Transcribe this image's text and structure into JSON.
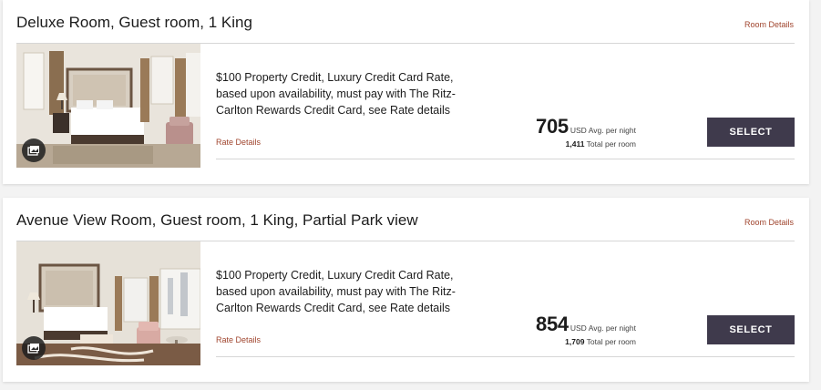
{
  "rooms": [
    {
      "title": "Deluxe Room, Guest room, 1 King",
      "room_details_label": "Room Details",
      "rate_description": "$100 Property Credit, Luxury Credit Card Rate, based upon availability, must pay with The Ritz-Carlton Rewards Credit Card, see Rate details",
      "rate_details_label": "Rate Details",
      "price": "705",
      "price_unit": "USD Avg. per night",
      "total": "1,411",
      "total_label": "Total per room",
      "select_label": "SELECT",
      "photo_icon": "camera-gallery-icon"
    },
    {
      "title": "Avenue View Room, Guest room, 1 King, Partial Park view",
      "room_details_label": "Room Details",
      "rate_description": "$100 Property Credit, Luxury Credit Card Rate, based upon availability, must pay with The Ritz-Carlton Rewards Credit Card, see Rate details",
      "rate_details_label": "Rate Details",
      "price": "854",
      "price_unit": "USD Avg. per night",
      "total": "1,709",
      "total_label": "Total per room",
      "select_label": "SELECT",
      "photo_icon": "camera-gallery-icon"
    }
  ],
  "colors": {
    "accent_link": "#a0452e",
    "select_button": "#3f3a4c",
    "page_background": "#f3f3f3"
  }
}
